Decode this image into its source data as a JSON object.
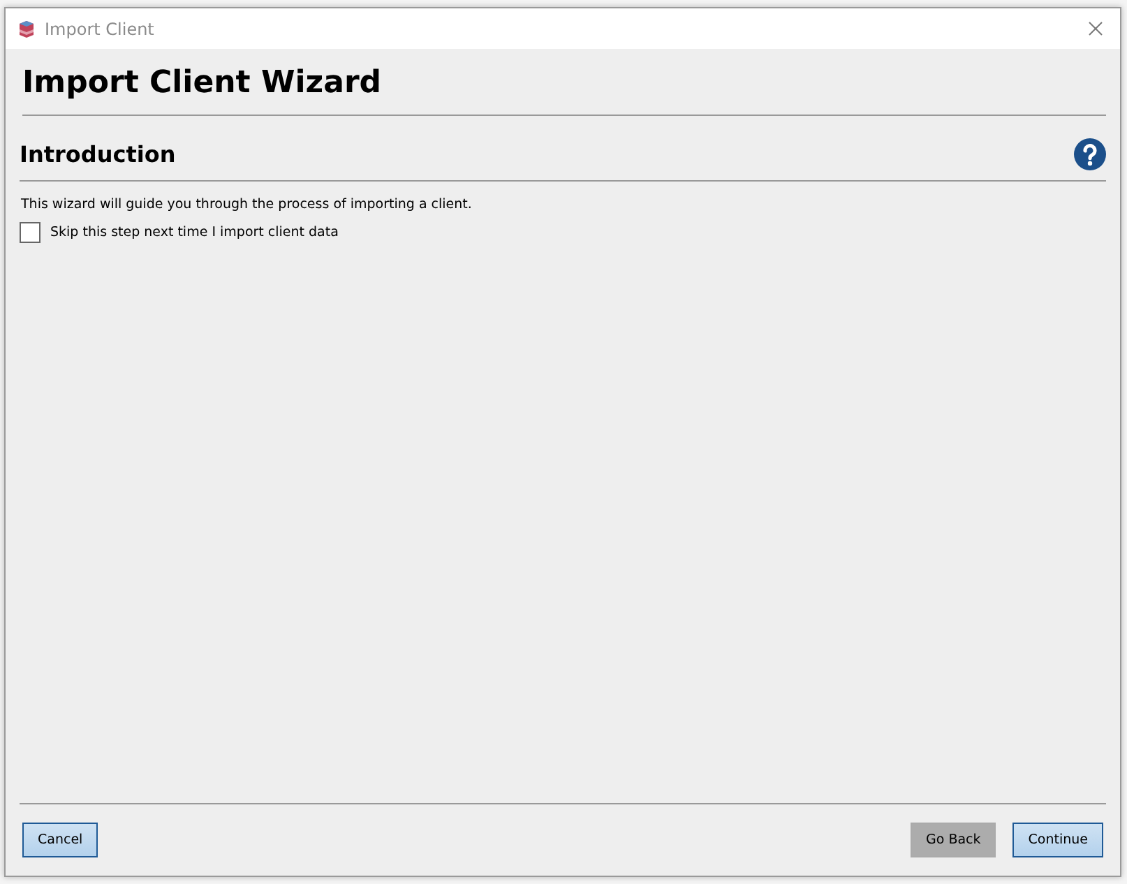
{
  "window": {
    "title": "Import Client"
  },
  "heading": "Import Client Wizard",
  "section": {
    "title": "Introduction"
  },
  "description": "This wizard will guide you through the process of importing a client.",
  "skip_checkbox": {
    "label": "Skip this step next time I import client data",
    "checked": false
  },
  "footer": {
    "left_buttons": [
      {
        "label": "Cancel",
        "disabled": false
      }
    ],
    "right_buttons": [
      {
        "label": "Go Back",
        "disabled": true
      },
      {
        "label": "Continue",
        "disabled": false
      }
    ]
  }
}
